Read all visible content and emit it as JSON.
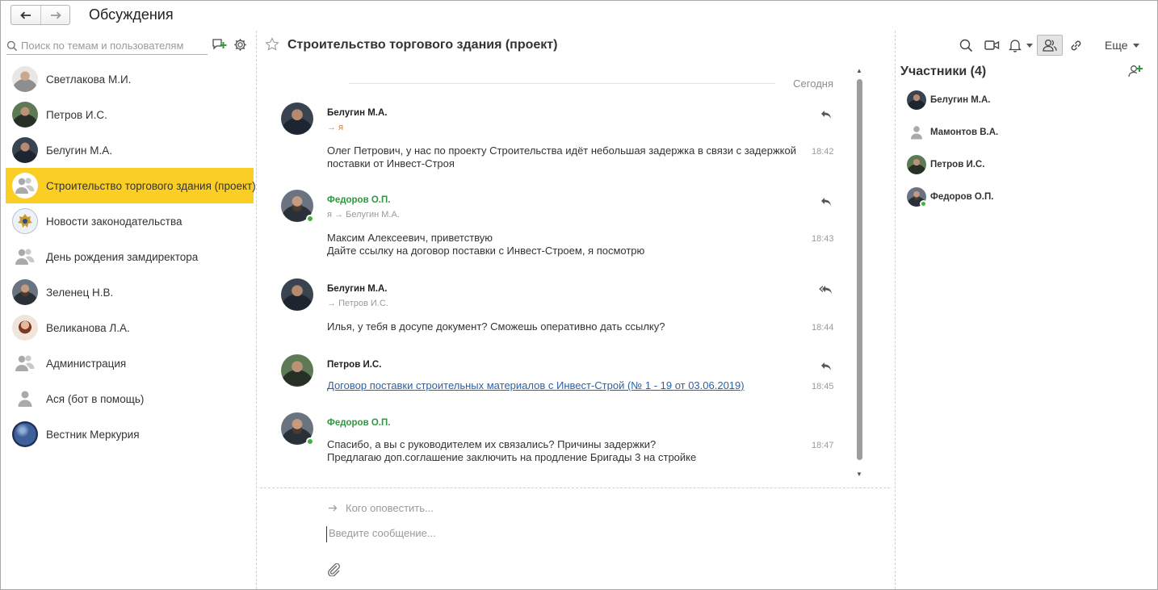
{
  "window": {
    "title": "Обсуждения",
    "back_icon": "arrow-left-icon",
    "forward_icon": "arrow-right-icon"
  },
  "sidebar": {
    "search_placeholder": "Поиск по темам и пользователям",
    "conversations": [
      {
        "label": "Светлакова М.И.",
        "avatar": "photo"
      },
      {
        "label": "Петров И.С.",
        "avatar": "photo"
      },
      {
        "label": "Белугин М.А.",
        "avatar": "photo"
      },
      {
        "label": "Строительство торгового здания (проект)",
        "avatar": "group-icon",
        "active": true
      },
      {
        "label": "Новости законодательства",
        "avatar": "emblem"
      },
      {
        "label": "День рождения замдиректора",
        "avatar": "group-icon"
      },
      {
        "label": "Зеленец Н.В.",
        "avatar": "photo"
      },
      {
        "label": "Великанова Л.А.",
        "avatar": "photo"
      },
      {
        "label": "Администрация",
        "avatar": "group-icon"
      },
      {
        "label": "Ася (бот в помощь)",
        "avatar": "user-icon"
      },
      {
        "label": "Вестник Меркурия",
        "avatar": "globe"
      }
    ]
  },
  "conversation": {
    "title": "Строительство торгового здания (проект)",
    "more_label": "Еще",
    "date_separator": "Сегодня",
    "messages": [
      {
        "author": "Белугин М.А.",
        "arrow": "→",
        "route_target": "я",
        "text_lines": [
          "Олег Петрович, у нас по проекту Строительства идёт небольшая задержка в связи с задержкой",
          "поставки от Инвест-Строя"
        ],
        "time": "18:42"
      },
      {
        "author": "Федоров О.П.",
        "route_from": "я",
        "arrow": "→",
        "route_target": "Белугин М.А.",
        "text_lines": [
          "Максим Алексеевич, приветствую",
          "Дайте ссылку на договор поставки с Инвест-Строем, я посмотрю"
        ],
        "time": "18:43"
      },
      {
        "author": "Белугин М.А.",
        "arrow": "→",
        "route_target": "Петров И.С.",
        "text_lines": [
          "Илья, у тебя в досупе документ? Сможешь оперативно дать ссылку?"
        ],
        "time": "18:44"
      },
      {
        "author": "Петров И.С.",
        "link": "Договор поставки строительных материалов с Инвест-Строй (№ 1 - 19 от 03.06.2019)",
        "time": "18:45"
      },
      {
        "author": "Федоров О.П.",
        "text_lines": [
          "Спасибо, а вы с руководителем их связались? Причины задержки?",
          "Предлагаю доп.соглашение заключить на продление Бригады 3 на стройке"
        ],
        "time": "18:47"
      }
    ],
    "composer": {
      "notify_placeholder": "Кого оповестить...",
      "message_placeholder": "Введите сообщение..."
    }
  },
  "participants": {
    "title": "Участники (4)",
    "items": [
      {
        "name": "Белугин М.А."
      },
      {
        "name": "Мамонтов В.А."
      },
      {
        "name": "Петров И.С."
      },
      {
        "name": "Федоров О.П.",
        "online": true
      }
    ]
  },
  "colors": {
    "active_item": "#fbce26",
    "online": "#41b23a",
    "author_green": "#2c9a3c",
    "link": "#2a62a9",
    "recipient_me": "#e07a1e"
  }
}
